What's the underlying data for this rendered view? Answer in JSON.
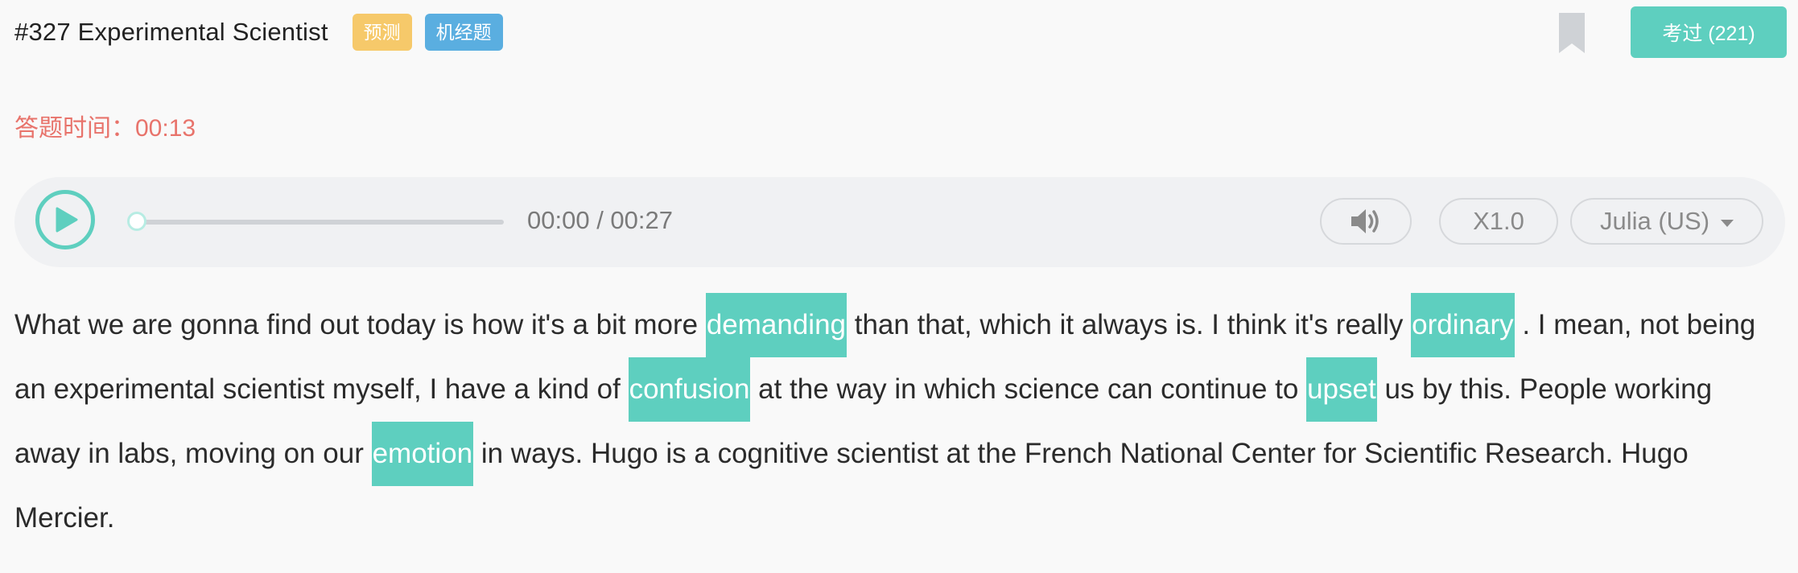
{
  "header": {
    "title": "#327 Experimental Scientist",
    "badges": {
      "predict": "预测",
      "jijing": "机经题"
    },
    "pass_button": "考过 (221)"
  },
  "timer": {
    "label": "答题时间：",
    "value": "00:13"
  },
  "player": {
    "current_time": "00:00",
    "separator": " / ",
    "total_time": "00:27",
    "speed": "X1.0",
    "voice": "Julia (US)",
    "progress": 0
  },
  "transcript": {
    "s1": "What we are gonna find out today is how it's a bit more ",
    "b1": "demanding",
    "s2": " than that, which it always is. I think it's really ",
    "b2": "ordinary",
    "s3": " . I mean, not being an experimental scientist myself, I have a kind of ",
    "b3": "confusion",
    "s4": " at the way in which science can continue to ",
    "b4": "upset",
    "s5": " us by this. People working away in labs, moving on our ",
    "b5": "emotion",
    "s6": " in ways. Hugo is a cognitive scientist at the French National Center for Scientific Research. Hugo Mercier."
  },
  "colors": {
    "accent": "#5ecfbf",
    "timer": "#e8736b",
    "predict": "#f6c96a",
    "jijing": "#5aaee0"
  }
}
